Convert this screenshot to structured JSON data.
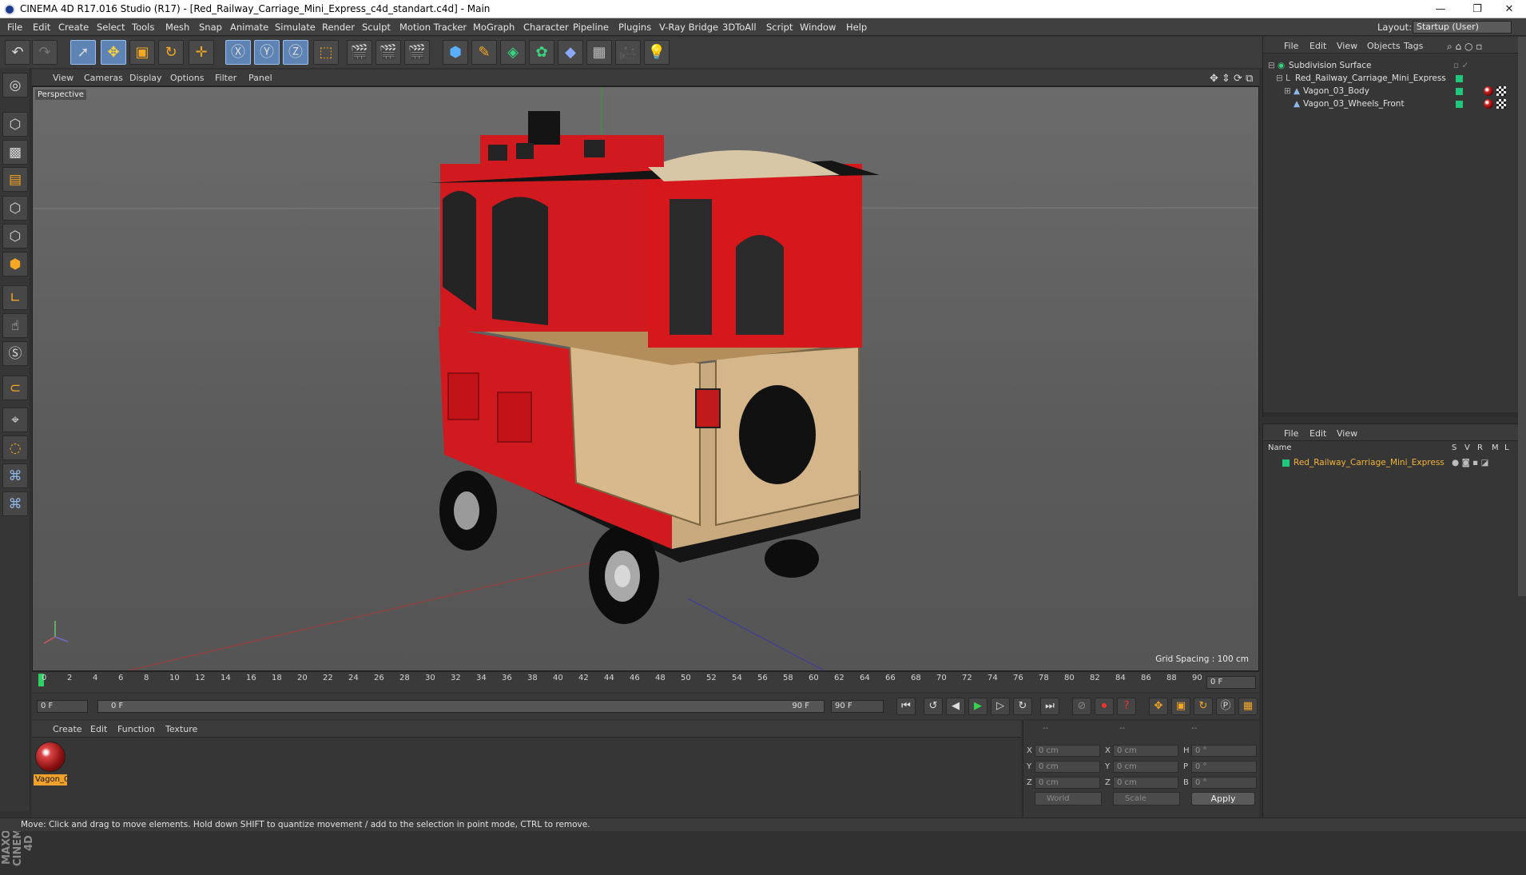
{
  "window": {
    "title": "CINEMA 4D R17.016 Studio (R17) - [Red_Railway_Carriage_Mini_Express_c4d_standart.c4d] - Main",
    "minimize": "—",
    "restore": "❐",
    "close": "✕"
  },
  "menu": [
    "File",
    "Edit",
    "Create",
    "Select",
    "Tools",
    "Mesh",
    "Snap",
    "Animate",
    "Simulate",
    "Render",
    "Sculpt",
    "Motion Tracker",
    "MoGraph",
    "Character",
    "Pipeline",
    "Plugins",
    "V-Ray Bridge",
    "3DToAll",
    "Script",
    "Window",
    "Help"
  ],
  "layout": {
    "label": "Layout:",
    "value": "Startup (User)"
  },
  "viewport": {
    "menu": [
      "View",
      "Cameras",
      "Display",
      "Options",
      "Filter",
      "Panel"
    ],
    "camera_label": "Perspective",
    "grid_spacing": "Grid Spacing : 100 cm"
  },
  "timeline": {
    "ticks": [
      "0",
      "2",
      "4",
      "6",
      "8",
      "10",
      "12",
      "14",
      "16",
      "18",
      "20",
      "22",
      "24",
      "26",
      "28",
      "30",
      "32",
      "34",
      "36",
      "38",
      "40",
      "42",
      "44",
      "46",
      "48",
      "50",
      "52",
      "54",
      "56",
      "58",
      "60",
      "62",
      "64",
      "66",
      "68",
      "70",
      "72",
      "74",
      "76",
      "78",
      "80",
      "82",
      "84",
      "86",
      "88",
      "90"
    ],
    "current_frame": "0 F",
    "start_frame": "0 F",
    "range_start": "0 F",
    "range_end": "90 F",
    "end_frame": "90 F"
  },
  "material_manager": {
    "menu": [
      "Create",
      "Edit",
      "Function",
      "Texture"
    ],
    "material_name": "Vagon_0"
  },
  "coordinates": {
    "header": [
      "--",
      "--",
      "--"
    ],
    "rows": [
      {
        "a": "X",
        "av": "0 cm",
        "b": "X",
        "bv": "0 cm",
        "c": "H",
        "cv": "0 °"
      },
      {
        "a": "Y",
        "av": "0 cm",
        "b": "Y",
        "bv": "0 cm",
        "c": "P",
        "cv": "0 °"
      },
      {
        "a": "Z",
        "av": "0 cm",
        "b": "Z",
        "bv": "0 cm",
        "c": "B",
        "cv": "0 °"
      }
    ],
    "mode1": "World",
    "mode2": "Scale",
    "apply": "Apply"
  },
  "object_manager": {
    "menu": [
      "File",
      "Edit",
      "View",
      "Objects",
      "Tags"
    ],
    "objects": [
      {
        "name": "Subdivision Surface",
        "indent": 0
      },
      {
        "name": "Red_Railway_Carriage_Mini_Express",
        "indent": 1
      },
      {
        "name": "Vagon_03_Body",
        "indent": 2
      },
      {
        "name": "Vagon_03_Wheels_Front",
        "indent": 2
      }
    ]
  },
  "attribute_manager": {
    "menu": [
      "File",
      "Edit",
      "View"
    ],
    "columns": [
      "Name",
      "S",
      "V",
      "R",
      "M",
      "L"
    ],
    "row": "Red_Railway_Carriage_Mini_Express"
  },
  "status": "Move: Click and drag to move elements. Hold down SHIFT to quantize movement / add to the selection in point mode, CTRL to remove.",
  "maxon_logo": "MAXON CINEMA 4D",
  "colors": {
    "accent": "#5e83b5",
    "object_green": "#1fc67b",
    "material_orange": "#f0a12c",
    "carriage_red": "#d11a1f"
  }
}
